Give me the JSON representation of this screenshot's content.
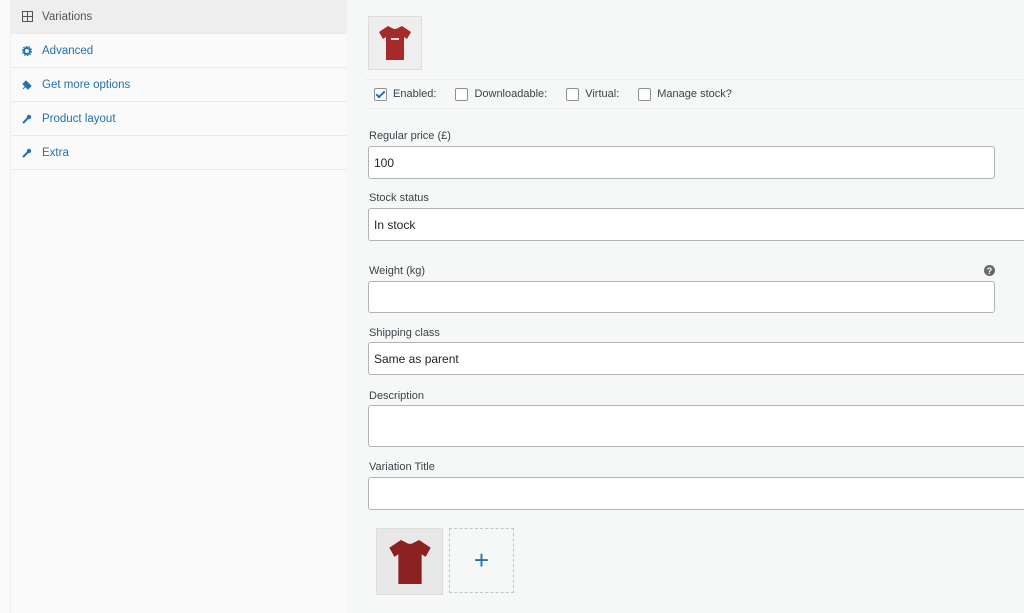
{
  "sidebar": {
    "items": [
      {
        "label": "Variations",
        "icon": "grid-icon"
      },
      {
        "label": "Advanced",
        "icon": "gear-icon"
      },
      {
        "label": "Get more options",
        "icon": "plugin-icon"
      },
      {
        "label": "Product layout",
        "icon": "wrench-icon"
      },
      {
        "label": "Extra",
        "icon": "wrench-icon"
      }
    ]
  },
  "variation": {
    "options": {
      "enabled": "Enabled:",
      "downloadable": "Downloadable:",
      "virtual": "Virtual:",
      "manage_stock": "Manage stock?"
    },
    "regular_price": {
      "label": "Regular price (£)",
      "value": "100"
    },
    "stock_status": {
      "label": "Stock status",
      "value": "In stock"
    },
    "weight": {
      "label": "Weight (kg)",
      "value": ""
    },
    "shipping_class": {
      "label": "Shipping class",
      "value": "Same as parent"
    },
    "description": {
      "label": "Description",
      "value": ""
    },
    "variation_title": {
      "label": "Variation Title",
      "value": ""
    },
    "help_glyph": "?",
    "add_glyph": "+"
  },
  "colors": {
    "accent": "#2271b1",
    "shirt": "#a52a2a"
  }
}
